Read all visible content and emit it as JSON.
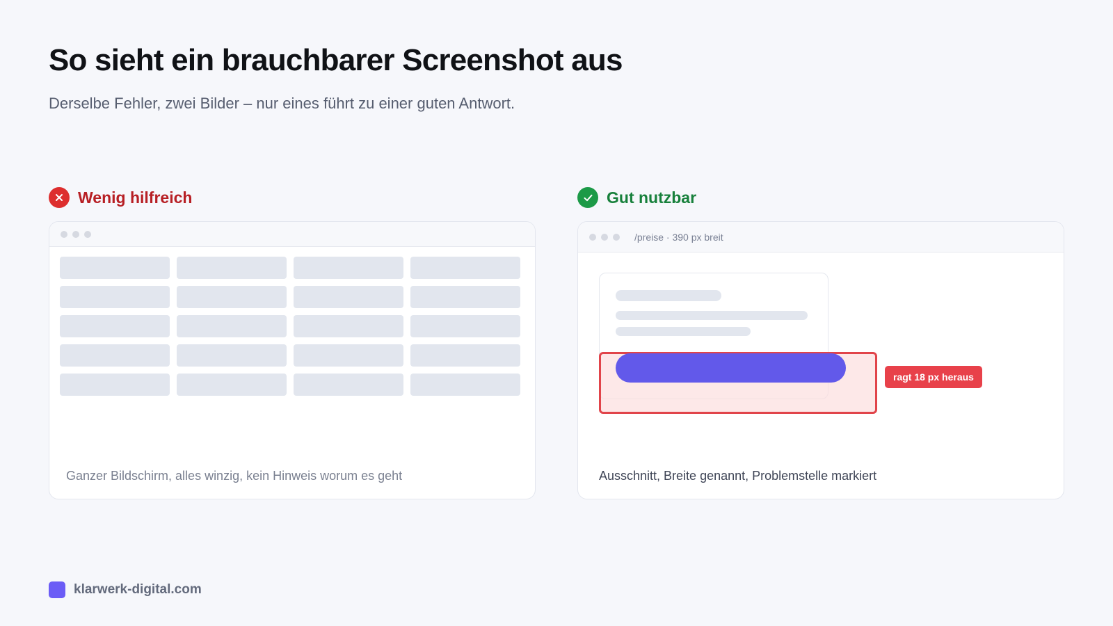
{
  "header": {
    "title": "So sieht ein brauchbarer Screenshot aus",
    "subtitle": "Derselbe Fehler, zwei Bilder – nur eines führt zu einer guten Antwort."
  },
  "bad_example": {
    "label": "Wenig hilfreich",
    "icon": "x-icon",
    "color": "#dd2e2e",
    "caption": "Ganzer Bildschirm, alles winzig, kein Hinweis worum es geht"
  },
  "good_example": {
    "label": "Gut nutzbar",
    "icon": "check-icon",
    "color": "#1c9a47",
    "url_label": "/preise · 390 px breit",
    "annotation": "ragt 18 px heraus",
    "caption": "Ausschnitt, Breite genannt, Problemstelle markiert"
  },
  "colors": {
    "accent": "#6259ea",
    "error": "#e1444a"
  },
  "footer": {
    "site": "klarwerk-digital.com"
  }
}
